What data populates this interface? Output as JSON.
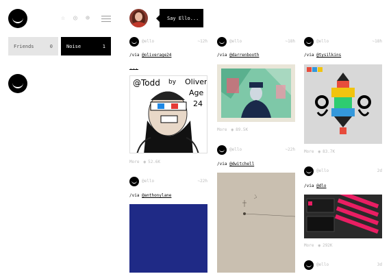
{
  "nav": {
    "icons": [
      "star-icon",
      "compass-icon",
      "globe-icon",
      "menu-icon"
    ],
    "tabs": [
      {
        "label": "Friends",
        "count": "0"
      },
      {
        "label": "Noise",
        "count": "1"
      }
    ]
  },
  "profile": {
    "say_hello": "Say Ello..."
  },
  "posts": {
    "col1_a": {
      "user": "@ello",
      "age": "~12h",
      "via_prefix": "/via ",
      "via_user": "@oliverage24",
      "ellipsis": "...",
      "drawing": {
        "text_top_left": "@Todd",
        "text_by": "by",
        "text_name": "Oliver",
        "text_age": "Age",
        "text_num": "24"
      },
      "more": "More",
      "views": "52.6K"
    },
    "col1_b": {
      "user": "@ello",
      "age": "~22h",
      "via_prefix": "/via ",
      "via_user": "@anthonylane"
    },
    "col2_a": {
      "user": "@ello",
      "age": "~18h",
      "via_prefix": "/via ",
      "via_user": "@darrenbooth",
      "more": "More",
      "views": "89.5K"
    },
    "col2_b": {
      "user": "@ello",
      "age": "~22h",
      "via_prefix": "/via ",
      "via_user": "@dwitchell"
    },
    "col3_a": {
      "user": "@ello",
      "age": "~18h",
      "via_prefix": "/via ",
      "via_user": "@tysilkins",
      "more": "More",
      "views": "83.7K"
    },
    "col3_b": {
      "user": "@ello",
      "age": "2d",
      "via_prefix": "/via ",
      "via_user": "@dlo",
      "more": "More",
      "views": "292K"
    },
    "col3_c": {
      "user": "@ello",
      "age": "3d"
    }
  },
  "colors": {
    "black": "#000000",
    "grey_tab": "#e5e5e5",
    "meta_grey": "#bbbbbb",
    "blue_block": "#1f2a86"
  }
}
